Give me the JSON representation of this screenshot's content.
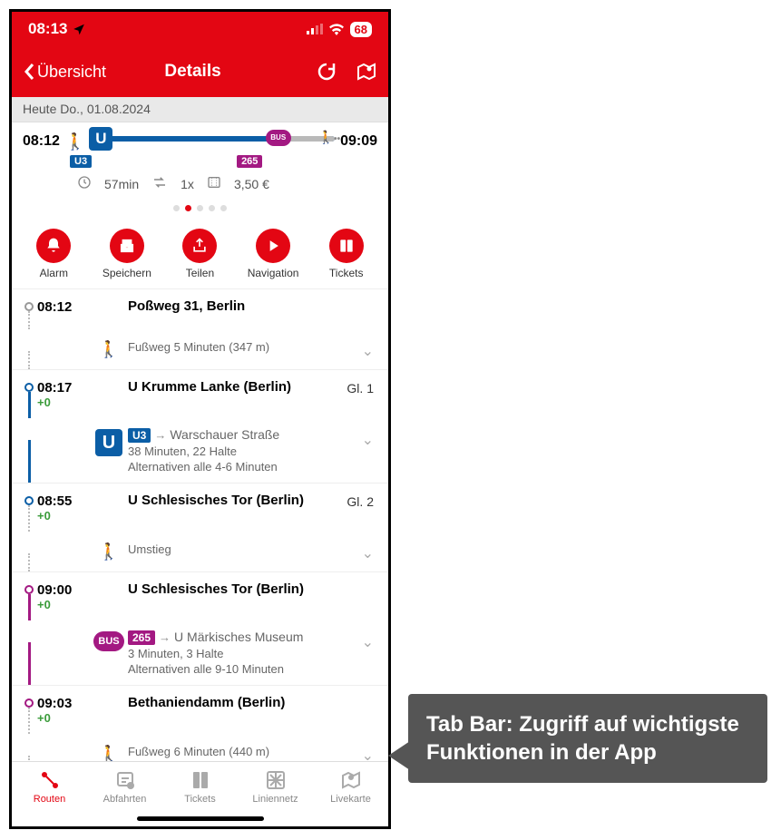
{
  "status": {
    "time": "08:13",
    "battery": "68"
  },
  "nav": {
    "back": "Übersicht",
    "title": "Details"
  },
  "date": "Heute Do., 01.08.2024",
  "trip": {
    "depart": "08:12",
    "arrive": "09:09",
    "ubahn_symbol": "U",
    "bus_symbol": "BUS",
    "line1": "U3",
    "line2": "265",
    "duration": "57min",
    "changes": "1x",
    "price": "3,50 €"
  },
  "actions": {
    "alarm": "Alarm",
    "save": "Speichern",
    "share": "Teilen",
    "nav": "Navigation",
    "tickets": "Tickets"
  },
  "steps": {
    "s0": {
      "time": "08:12",
      "title": "Poßweg 31, Berlin"
    },
    "s1": {
      "sub": "Fußweg 5 Minuten (347 m)"
    },
    "s2": {
      "time": "08:17",
      "delay": "+0",
      "title": "U Krumme Lanke (Berlin)",
      "platform": "Gl. 1"
    },
    "s3": {
      "line": "U3",
      "dir": "Warschauer Straße",
      "sub1": "38 Minuten, 22 Halte",
      "sub2": "Alternativen alle 4-6 Minuten"
    },
    "s4": {
      "time": "08:55",
      "delay": "+0",
      "title": "U Schlesisches Tor (Berlin)",
      "platform": "Gl. 2"
    },
    "s5": {
      "sub": "Umstieg"
    },
    "s6": {
      "time": "09:00",
      "delay": "+0",
      "title": "U Schlesisches Tor (Berlin)"
    },
    "s7": {
      "line": "265",
      "dir": "U Märkisches Museum",
      "sub1": "3 Minuten, 3 Halte",
      "sub2": "Alternativen alle 9-10 Minuten"
    },
    "s8": {
      "time": "09:03",
      "delay": "+0",
      "title": "Bethaniendamm (Berlin)"
    },
    "s9": {
      "sub": "Fußweg 6 Minuten (440 m)"
    }
  },
  "tabs": {
    "routes": "Routen",
    "departures": "Abfahrten",
    "tickets": "Tickets",
    "network": "Liniennetz",
    "livemap": "Livekarte"
  },
  "callout": "Tab Bar: Zugriff auf wichtigste Funktionen in der App"
}
